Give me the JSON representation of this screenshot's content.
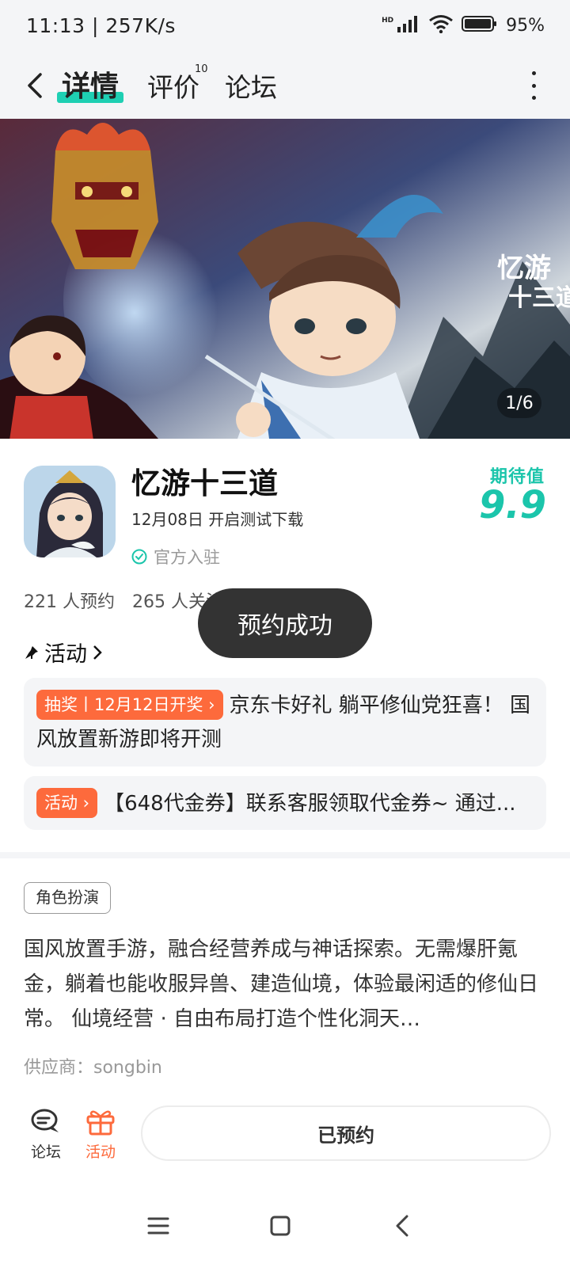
{
  "status_bar": {
    "time": "11:13 | 257K/s",
    "signal_label": "HD",
    "battery": "95%"
  },
  "nav": {
    "tabs": [
      {
        "label": "详情"
      },
      {
        "label": "评价",
        "count": "10"
      },
      {
        "label": "论坛"
      }
    ]
  },
  "banner": {
    "counter": "1/6",
    "logo_text": "忆游十三道"
  },
  "app": {
    "name": "忆游十三道",
    "date": "12月08日 开启测试下载",
    "official": "官方入驻",
    "expect_label": "期待值",
    "expect_value": "9.9"
  },
  "counts": {
    "reserve": "221 人预约",
    "follow": "265 人关注"
  },
  "activity": {
    "header": "活动",
    "items": [
      {
        "tag": "抽奖丨12月12日开奖 ›",
        "text": "京东卡好礼 躺平修仙党狂喜！ 国风放置新游即将开测"
      },
      {
        "tag": "活动 ›",
        "text": "【648代金券】联系客服领取代金券~ 通过..."
      }
    ]
  },
  "genre": "角色扮演",
  "description": "国风放置手游，融合经营养成与神话探索。无需爆肝氪金，躺着也能收服异兽、建造仙境，体验最闲适的修仙日常。 仙境经营 · 自由布局打造个性化洞天…",
  "supplier": "供应商：songbin",
  "bottom": {
    "forum_label": "论坛",
    "activity_label": "活动",
    "reserved_label": "已预约"
  },
  "toast": "预约成功",
  "colors": {
    "accent": "#1bc5ab",
    "orange": "#fd6a3c"
  }
}
